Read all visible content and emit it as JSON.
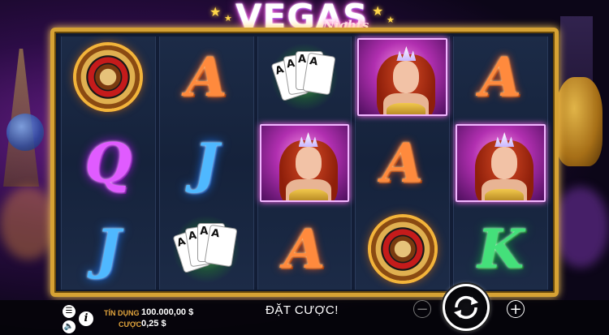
{
  "logo": {
    "main": "VEGAS",
    "sub": "Nights"
  },
  "reels": [
    [
      "roulette",
      "Q",
      "J"
    ],
    [
      "A",
      "J",
      "cards"
    ],
    [
      "cards",
      "lady",
      "A"
    ],
    [
      "lady",
      "A",
      "roulette"
    ],
    [
      "A",
      "lady",
      "K"
    ]
  ],
  "bottom": {
    "credit_label": "TÍN DỤNG",
    "credit_value": "100.000,00 $",
    "bet_label": "CƯỢC",
    "bet_value": "0,25 $",
    "message": "ĐẶT CƯỢC!",
    "minus": "−",
    "plus": "+",
    "info": "i"
  },
  "icons": {
    "menu": "menu-icon",
    "sound": "sound-icon",
    "info": "info-icon",
    "spin": "spin-icon"
  },
  "colors": {
    "frame": "#d6a234",
    "label": "#e2a53d"
  }
}
